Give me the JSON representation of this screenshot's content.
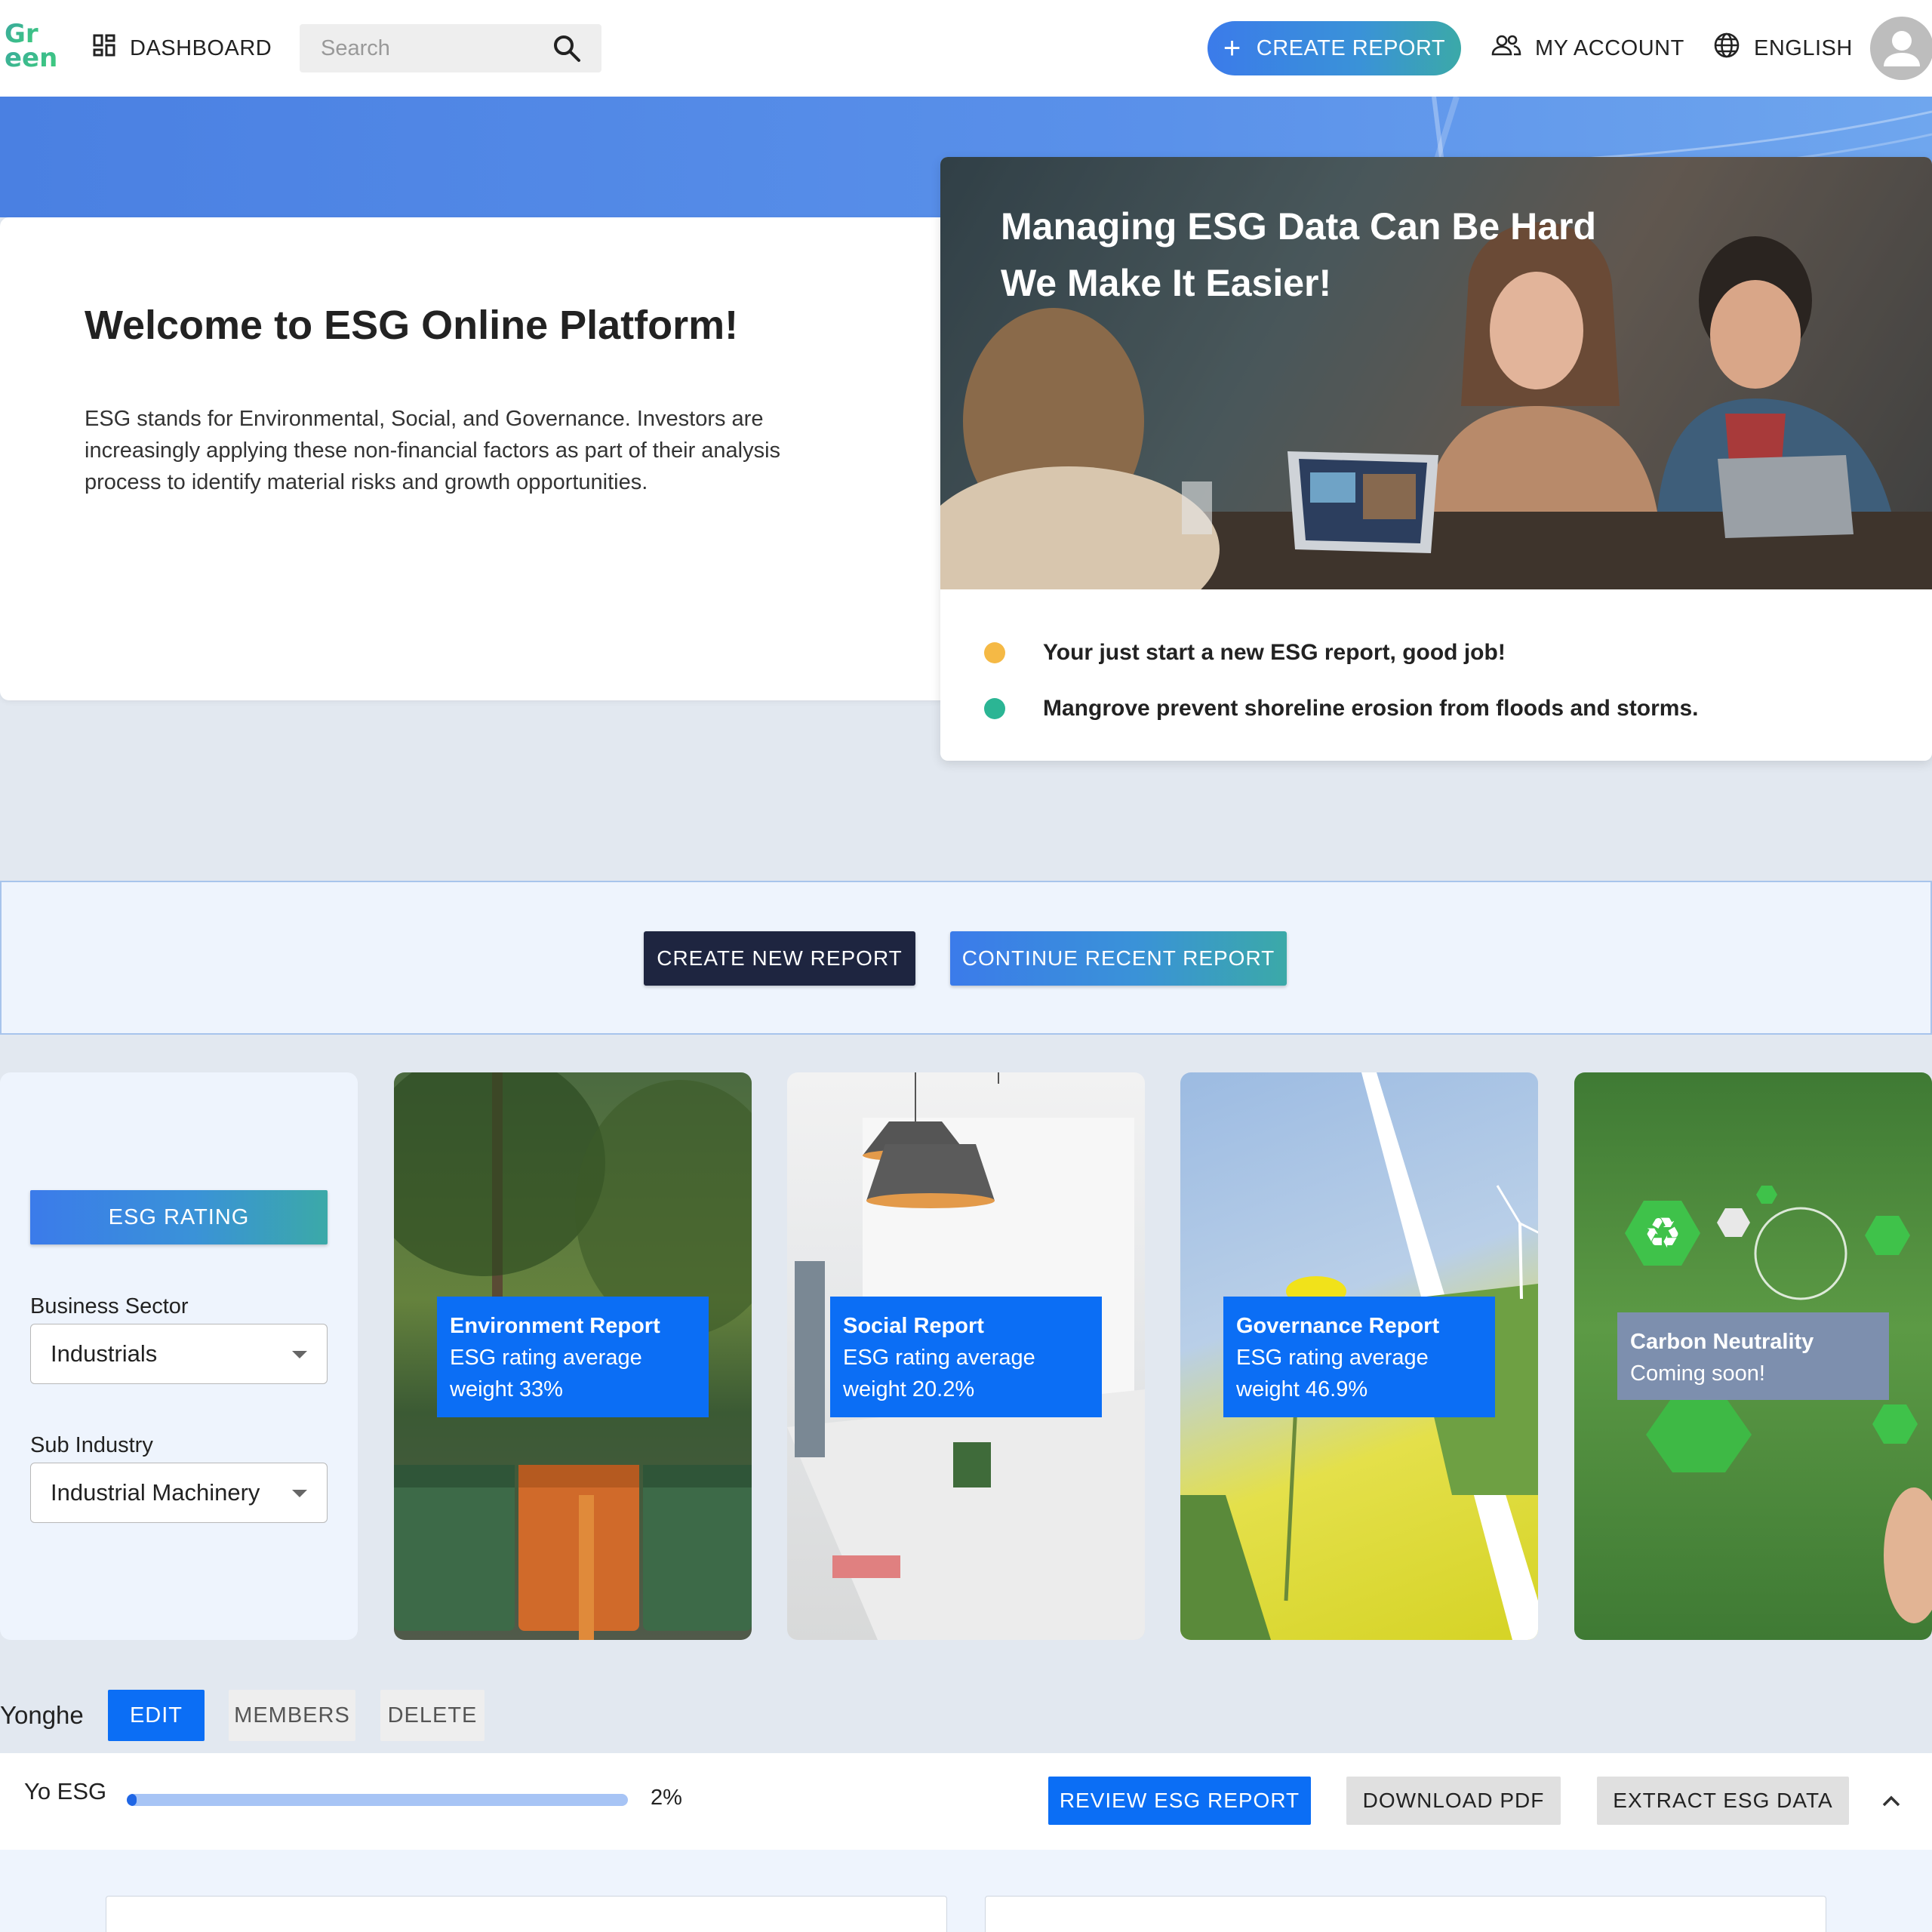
{
  "nav": {
    "dashboard_label": "DASHBOARD",
    "search_placeholder": "Search",
    "create_report_label": "CREATE REPORT",
    "account_label": "MY ACCOUNT",
    "language_label": "ENGLISH"
  },
  "welcome": {
    "title": "Welcome to ESG Online Platform!",
    "text": "ESG stands for Environmental, Social, and Governance. Investors are increasingly applying these non-financial factors as part of their analysis process to identify material risks and growth opportunities."
  },
  "promo": {
    "headline_line1": "Managing ESG Data Can Be Hard",
    "headline_line2": "We Make It Easier!",
    "items": [
      {
        "text": "Your just start a new ESG report, good job!",
        "color": "#f5b945"
      },
      {
        "text": "Mangrove prevent shoreline erosion from floods and storms.",
        "color": "#2bb594"
      }
    ]
  },
  "actions": {
    "create_new": "CREATE NEW REPORT",
    "continue_recent": "CONTINUE RECENT REPORT"
  },
  "rating": {
    "button_label": "ESG RATING",
    "sector_label": "Business Sector",
    "sector_value": "Industrials",
    "sub_label": "Sub Industry",
    "sub_value": "Industrial Machinery"
  },
  "cards": [
    {
      "title": "Environment Report",
      "line1": "ESG rating average",
      "line2": "weight 33%"
    },
    {
      "title": "Social Report",
      "line1": "ESG rating average",
      "line2": "weight 20.2%"
    },
    {
      "title": "Governance Report",
      "line1": "ESG rating average",
      "line2": "weight 46.9%"
    },
    {
      "title": "Carbon Neutrality",
      "line1": "Coming soon!"
    }
  ],
  "project": {
    "name": "Yonghe",
    "edit": "EDIT",
    "members": "MEMBERS",
    "delete": "DELETE"
  },
  "report": {
    "name": "Yo ESG",
    "progress": 0.02,
    "progress_text": "2%",
    "review": "REVIEW ESG REPORT",
    "download": "DOWNLOAD PDF",
    "extract": "EXTRACT ESG DATA"
  },
  "colors": {
    "accent_blue": "#0b6ef5",
    "brand_gradient_start": "#3b7bea",
    "brand_gradient_end": "#3ba9a8",
    "dark_button": "#1e2540"
  },
  "icons": [
    "logo-icon",
    "dashboard-icon",
    "search-icon",
    "plus-icon",
    "people-icon",
    "globe-icon",
    "user-avatar-icon",
    "caret-down-icon",
    "chevron-up-icon",
    "recycle-icon"
  ]
}
